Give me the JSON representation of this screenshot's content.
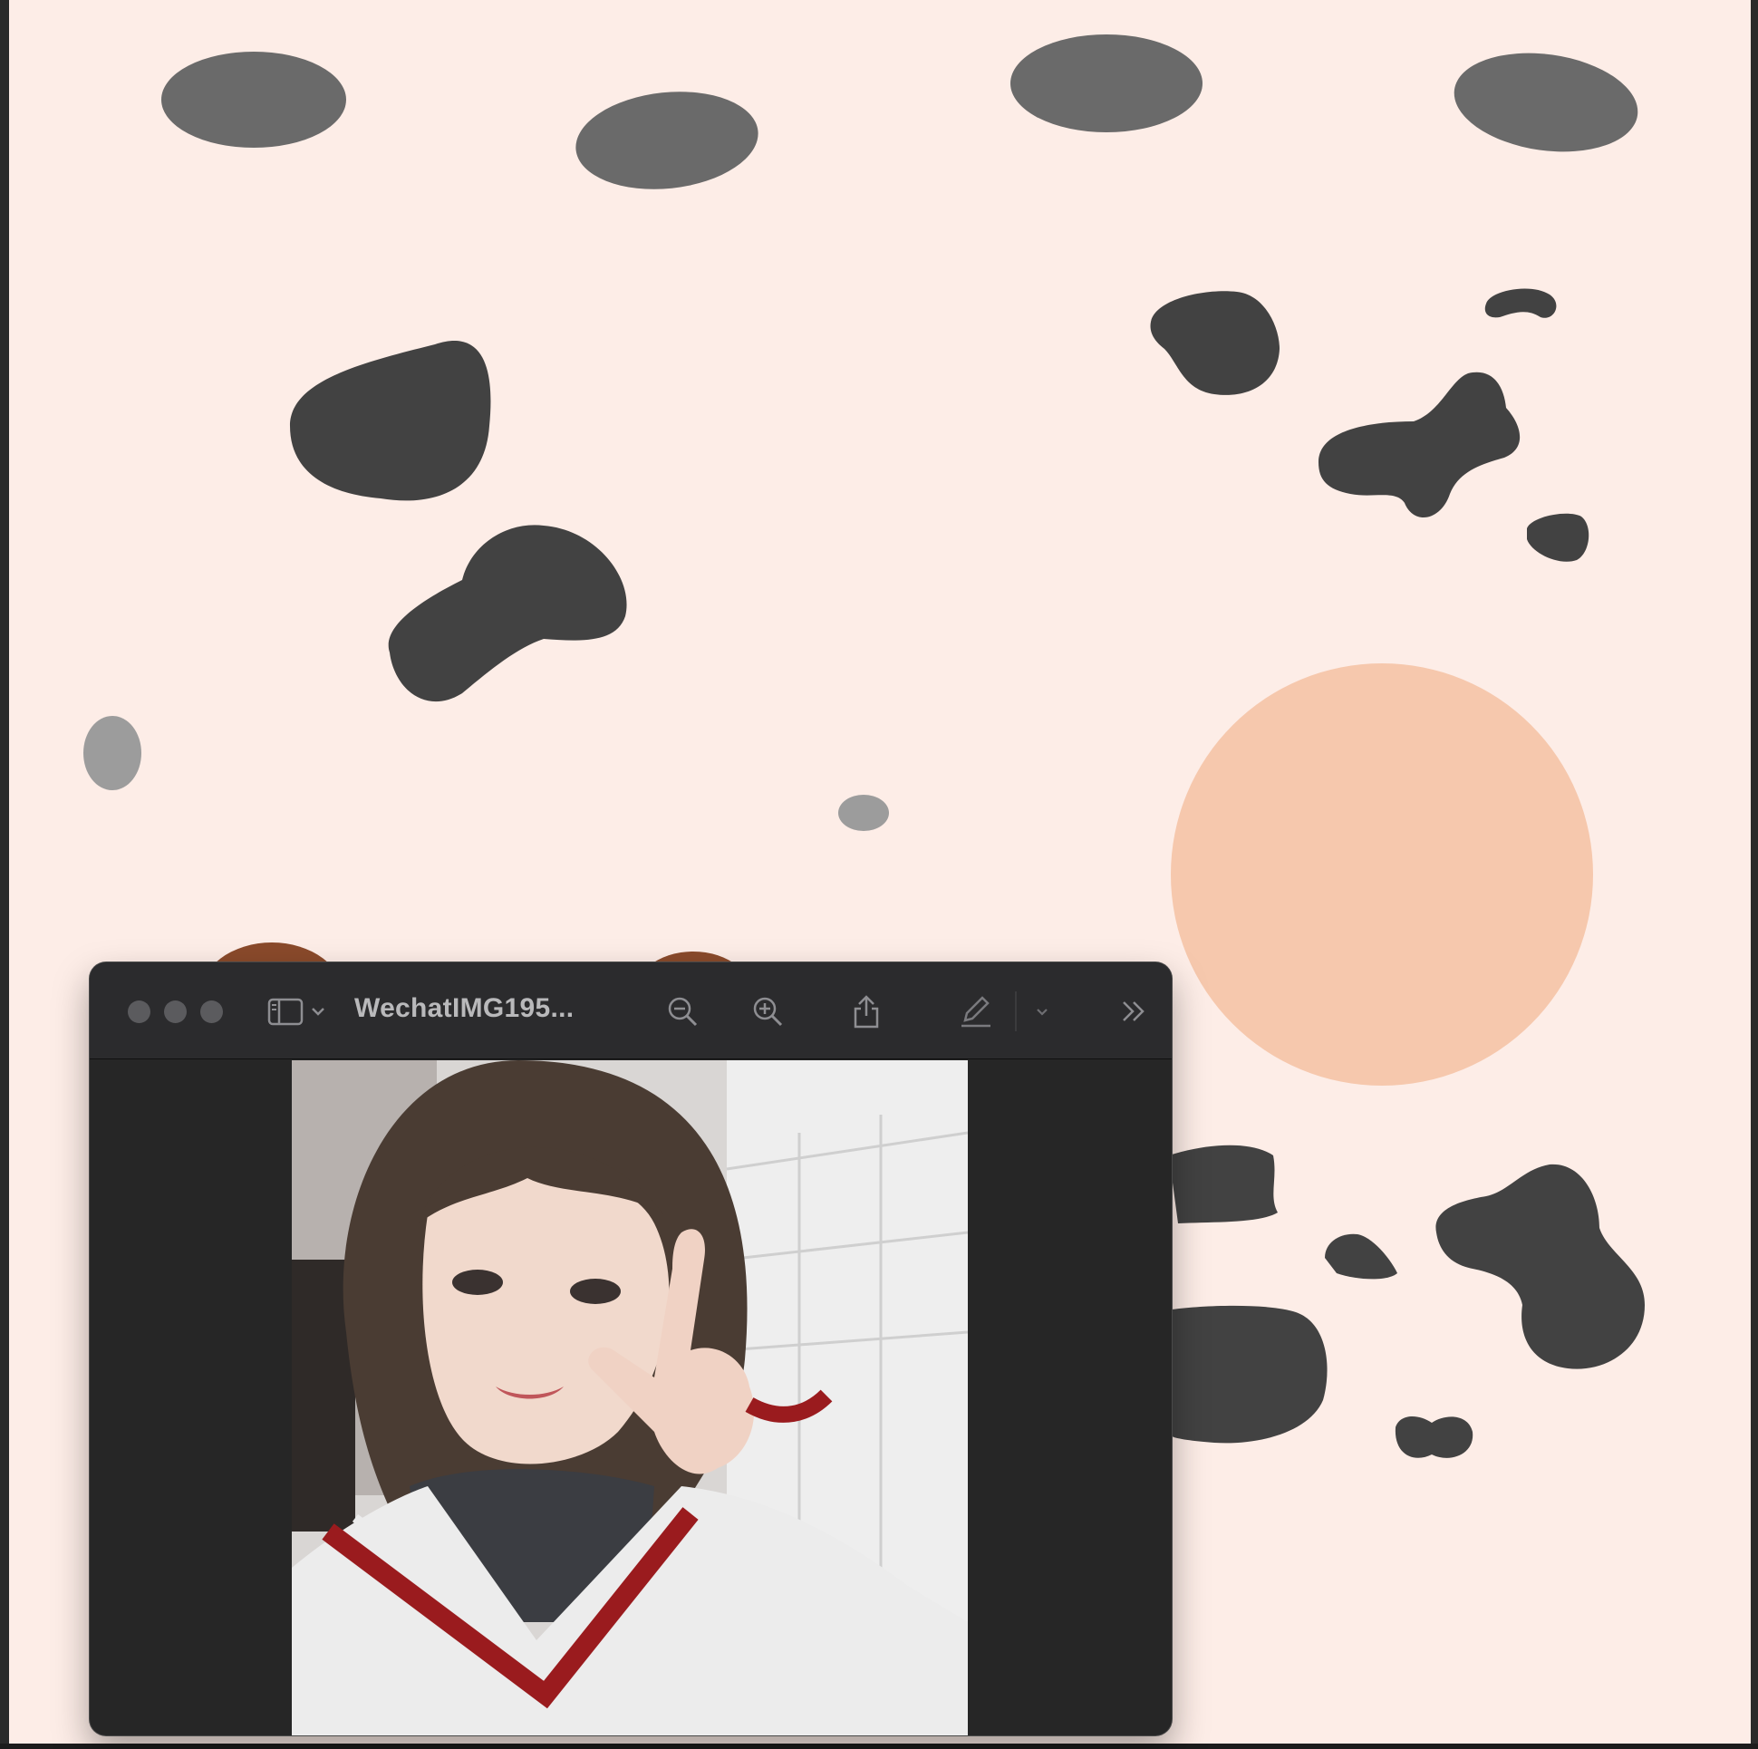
{
  "colors": {
    "wallpaper": "#fdede7",
    "spot_dark": "#424242",
    "spot_mid": "#6a6a6a",
    "spot_light": "#9c9c9c",
    "peach_circle": "#f6c8ad",
    "brown": "#8a4a2b",
    "window_bg": "#262626",
    "titlebar_bg": "#2b2b2d",
    "titlebar_icon": "#8e8e92",
    "sweater_white": "#ececec",
    "sweater_red": "#9a1b1e"
  },
  "preview_window": {
    "title": "WechatIMG195...",
    "toolbar": {
      "sidebar_icon": "sidebar-icon",
      "chevron_icon": "chevron-down-icon",
      "zoom_out_icon": "zoom-out-icon",
      "zoom_in_icon": "zoom-in-icon",
      "share_icon": "share-icon",
      "markup_icon": "pencil-markup-icon",
      "markup_menu_icon": "chevron-down-icon",
      "overflow_icon": "double-chevron-right-icon"
    },
    "image": {
      "subject": "selfie-photo"
    }
  }
}
